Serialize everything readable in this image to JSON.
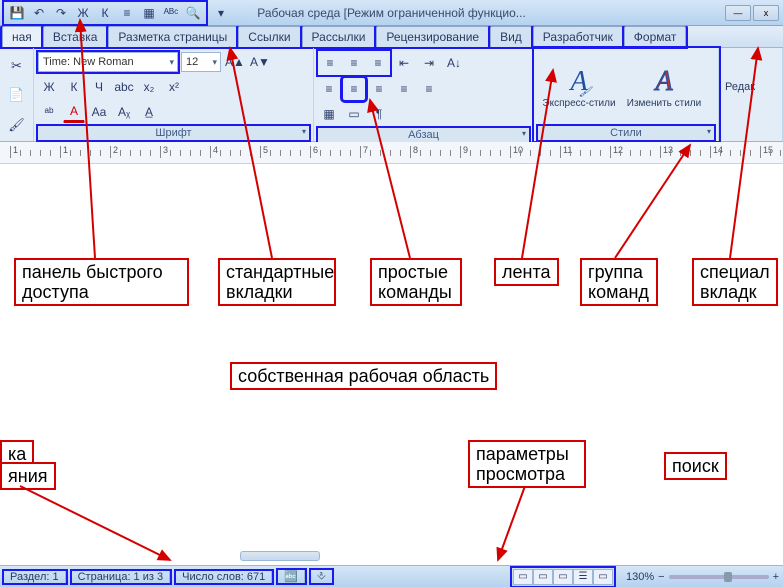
{
  "title": "Рабочая среда [Режим ограниченной функцио...",
  "qat": {
    "items": [
      {
        "name": "save-icon",
        "glyph": "💾"
      },
      {
        "name": "undo-dropdown-icon",
        "glyph": "↶"
      },
      {
        "name": "redo-icon",
        "glyph": "↷"
      },
      {
        "name": "bold-icon",
        "glyph": "Ж"
      },
      {
        "name": "italic-icon",
        "glyph": "К"
      },
      {
        "name": "list-icon",
        "glyph": "≡"
      },
      {
        "name": "table-icon",
        "glyph": "▦"
      },
      {
        "name": "spellcheck-icon",
        "glyph": "ᴬᴮᶜ"
      },
      {
        "name": "preview-icon",
        "glyph": "🔍"
      }
    ],
    "dropdown_glyph": "▾"
  },
  "window_buttons": {
    "min": "—",
    "close": "x"
  },
  "tabs": {
    "items": [
      {
        "name": "tab-home",
        "label": "ная"
      },
      {
        "name": "tab-insert",
        "label": "Вставка"
      },
      {
        "name": "tab-page-layout",
        "label": "Разметка страницы"
      },
      {
        "name": "tab-references",
        "label": "Ссылки"
      },
      {
        "name": "tab-mailings",
        "label": "Рассылки"
      },
      {
        "name": "tab-review",
        "label": "Рецензирование"
      },
      {
        "name": "tab-view",
        "label": "Вид"
      },
      {
        "name": "tab-developer",
        "label": "Разработчик"
      },
      {
        "name": "tab-format",
        "label": "Формат"
      }
    ]
  },
  "clipboard": {
    "items": [
      {
        "name": "cut-icon",
        "glyph": "✂"
      },
      {
        "name": "copy-icon",
        "glyph": "📄"
      },
      {
        "name": "paste-brush-icon",
        "glyph": "🖌"
      }
    ]
  },
  "font": {
    "name": "Time:  New Roman",
    "size": "12",
    "row2": [
      {
        "name": "bold-icon",
        "glyph": "Ж"
      },
      {
        "name": "italic-icon",
        "glyph": "К"
      },
      {
        "name": "underline-icon",
        "glyph": "Ч"
      },
      {
        "name": "strike-icon",
        "glyph": "abc"
      },
      {
        "name": "subscript-icon",
        "glyph": "x₂"
      },
      {
        "name": "superscript-icon",
        "glyph": "x²"
      },
      {
        "name": "grow-icon",
        "glyph": "A▲"
      },
      {
        "name": "shrink-icon",
        "glyph": "A▼"
      }
    ],
    "row3": [
      {
        "name": "highlight-icon",
        "glyph": "ᵃᵇ"
      },
      {
        "name": "font-color-icon",
        "glyph": "A"
      },
      {
        "name": "change-case-icon",
        "glyph": "Aa"
      },
      {
        "name": "clear-format-icon",
        "glyph": "Aᵪ"
      },
      {
        "name": "char-border-icon",
        "glyph": "A̲"
      }
    ],
    "group_label": "Шрифт"
  },
  "paragraph": {
    "row1": [
      {
        "name": "bullets-icon",
        "glyph": "≡"
      },
      {
        "name": "numbering-icon",
        "glyph": "≡"
      },
      {
        "name": "multilevel-icon",
        "glyph": "≡"
      },
      {
        "name": "indent-left-icon",
        "glyph": "⇤"
      },
      {
        "name": "indent-right-icon",
        "glyph": "⇥"
      },
      {
        "name": "sort-icon",
        "glyph": "A↓"
      }
    ],
    "row2": [
      {
        "name": "align-left-icon",
        "glyph": "≡"
      },
      {
        "name": "align-center-icon",
        "glyph": "≡"
      },
      {
        "name": "align-right-icon",
        "glyph": "≡"
      },
      {
        "name": "justify-icon",
        "glyph": "≡"
      },
      {
        "name": "line-spacing-icon",
        "glyph": "≡"
      }
    ],
    "row3": [
      {
        "name": "shading-icon",
        "glyph": "▦"
      },
      {
        "name": "borders-icon",
        "glyph": "▭"
      },
      {
        "name": "show-marks-icon",
        "glyph": "¶"
      }
    ],
    "group_label": "Абзац"
  },
  "styles": {
    "quick_label": "Экспресс-стили",
    "change_label": "Изменить стили",
    "group_label": "Стили"
  },
  "editing": {
    "label": "Редак"
  },
  "ruler": {
    "numbers": [
      "1",
      "1",
      "2",
      "3",
      "4",
      "5",
      "6",
      "7",
      "8",
      "9",
      "10",
      "11",
      "12",
      "13",
      "14",
      "15"
    ]
  },
  "annotations": {
    "qat": "панель быстрого доступа",
    "std_tabs": "стандартные вкладки",
    "simple_cmds": "простые команды",
    "ribbon": "лента",
    "group": "группа команд",
    "special_tabs": "специал вкладк",
    "work_area": "собственная рабочая область",
    "status_left1": "ка",
    "status_left2": "яния",
    "view_params": "параметры просмотра",
    "search": "поиск"
  },
  "status": {
    "section": "Раздел: 1",
    "page": "Страница: 1 из 3",
    "words": "Число слов: 671",
    "lang_icon": "🔤",
    "insert_icon": "⎀",
    "zoom_pct": "130%",
    "zoom_plus": "+",
    "zoom_minus": "−"
  },
  "view_modes": [
    {
      "name": "print-layout-icon",
      "glyph": "▭"
    },
    {
      "name": "full-read-icon",
      "glyph": "▭"
    },
    {
      "name": "web-layout-icon",
      "glyph": "▭"
    },
    {
      "name": "outline-icon",
      "glyph": "☰"
    },
    {
      "name": "draft-icon",
      "glyph": "▭"
    }
  ]
}
